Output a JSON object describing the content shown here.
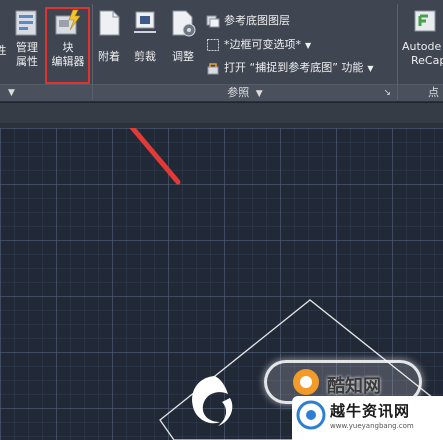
{
  "ribbon": {
    "tools": {
      "partial_left": "性",
      "manage_attr_line1": "管理",
      "manage_attr_line2": "属性",
      "block_editor_line1": "块",
      "block_editor_line2": "编辑器",
      "attach": "附着",
      "clip": "剪裁",
      "adjust": "调整",
      "autodesk_line1": "Autode",
      "autodesk_line2": "ReCap"
    },
    "reference_panel": {
      "underlay_layers": "参考底图图层",
      "frame_option": "*边框可变选项*",
      "snap_toggle": "打开 “捕捉到参考底图” 功能",
      "label": "参照"
    },
    "right_panel_label": "点"
  },
  "watermark": {
    "badge_text": "酷知网",
    "site_name": "越牛资讯网",
    "site_url": "www.yueyangbang.com"
  },
  "colors": {
    "ribbon_bg": "#3f4652",
    "canvas_bg": "#212836",
    "highlight_box": "#e0322f",
    "arrow": "#e23a36"
  }
}
